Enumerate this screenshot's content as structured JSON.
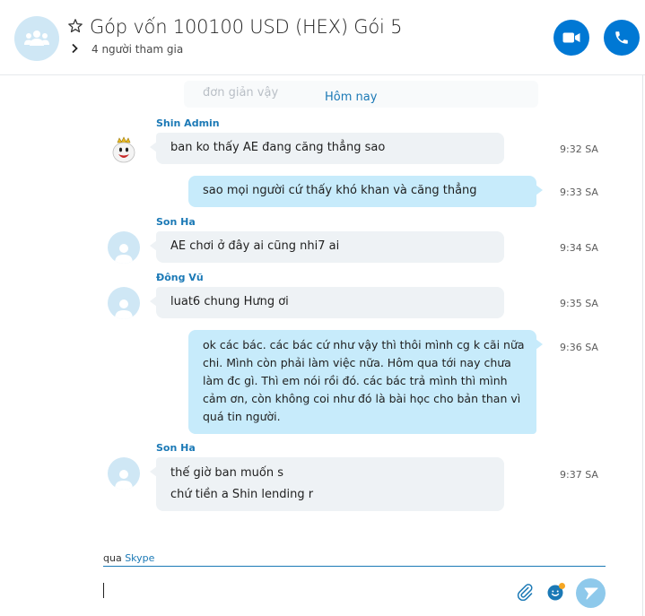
{
  "header": {
    "title": "Góp vốn 100100 USD (HEX) Gói 5",
    "participants": "4 người tham gia"
  },
  "colors": {
    "accent": "#0078d4",
    "sender_name": "#1b79b6",
    "outgoing_bubble": "#c7ebfb",
    "incoming_bubble": "#eef2f5",
    "avatar_bg": "#cfe7f5",
    "send_button": "#8ec9eb"
  },
  "icons": {
    "group": "group-icon",
    "favorite": "star-icon",
    "expand": "chevron-right-icon",
    "video": "video-camera-icon",
    "call": "phone-icon",
    "attach": "paperclip-icon",
    "emoji": "emoji-icon",
    "send": "send-icon"
  },
  "chat": {
    "faded_text": "đơn giản vậy",
    "date_separator": "Hôm nay",
    "messages": [
      {
        "sender": "Shin Admin",
        "lines": [
          "ban ko thấy AE đang căng thẳng sao"
        ],
        "time": "9:32 SA",
        "direction": "in"
      },
      {
        "sender": "",
        "lines": [
          "sao mọi người cứ thấy khó khan và căng thẳng"
        ],
        "time": "9:33 SA",
        "direction": "out"
      },
      {
        "sender": "Son Ha",
        "lines": [
          "AE chơi ở đây ai cũng nhi7 ai"
        ],
        "time": "9:34 SA",
        "direction": "in"
      },
      {
        "sender": "Đông Vũ",
        "lines": [
          "luat6 chung Hưng ơi"
        ],
        "time": "9:35 SA",
        "direction": "in"
      },
      {
        "sender": "",
        "lines": [
          "ok các bác. các bác cứ như vậy thì thôi mình cg k cãi nữa",
          "chi. Mình còn phải làm việc nữa. Hôm qua tới nay chưa",
          "làm đc gì. Thì em nói rồi đó. các bác trả mình thì mình",
          "cảm ơn, còn không coi như đó là bài học cho bản than vì",
          "quá tin người."
        ],
        "time": "9:36 SA",
        "direction": "out"
      },
      {
        "sender": "Son Ha",
        "lines": [
          "thế giờ ban muốn s",
          "chứ tiền a Shin lending r"
        ],
        "time": "9:37 SA",
        "direction": "in"
      }
    ]
  },
  "composer": {
    "via_prefix": "qua",
    "via_brand": "Skype",
    "input_value": "",
    "input_placeholder": ""
  }
}
